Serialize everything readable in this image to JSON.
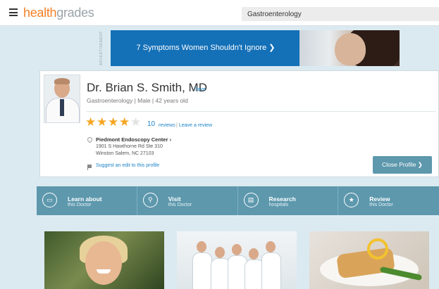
{
  "header": {
    "logo_part1": "health",
    "logo_part2": "grades",
    "search_value": "Gastroenterology"
  },
  "ad": {
    "label": "ADVERTISEMENT",
    "text": "7 Symptoms Women Shouldn't Ignore ❯"
  },
  "doctor": {
    "name": "Dr. Brian S. Smith, MD",
    "save_label": "Save",
    "subline": "Gastroenterology | Male | 42 years old",
    "rating": 4,
    "rating_max": 5,
    "review_count": "10",
    "reviews_label": "reviews",
    "leave_review_label": "Leave a review",
    "center_name": "Piedmont Endoscopy Center ›",
    "address_line1": "1901 S Hawthorne Rd Ste 310",
    "address_line2": "Winston Salem, NC 27103",
    "suggest_edit": "Suggest an edit to this profile",
    "close_label": "Close Profile ❯"
  },
  "actions": [
    {
      "title": "Learn about",
      "sub": "this Doctor",
      "icon": "book-icon"
    },
    {
      "title": "Visit",
      "sub": "this Doctor",
      "icon": "location-pin-icon"
    },
    {
      "title": "Research",
      "sub": "hospitals",
      "icon": "clipboard-icon"
    },
    {
      "title": "Review",
      "sub": "this Doctor",
      "icon": "star-icon"
    }
  ],
  "colors": {
    "brand_orange": "#f58026",
    "accent_blue": "#1d84c7",
    "teal_bar": "#5d98ad",
    "star_gold": "#f5a623"
  }
}
